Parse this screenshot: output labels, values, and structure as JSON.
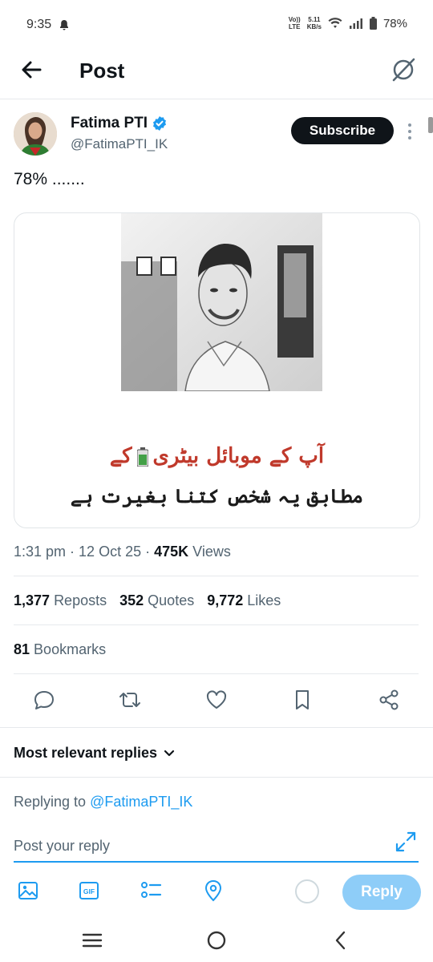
{
  "status_bar": {
    "time": "9:35",
    "volte": "Vo))\nLTE",
    "speed_value": "5.11",
    "speed_unit": "KB/s",
    "battery_text": "78%"
  },
  "header": {
    "title": "Post"
  },
  "author": {
    "name": "Fatima PTI",
    "handle": "@FatimaPTI_IK",
    "subscribe_label": "Subscribe"
  },
  "post": {
    "text": "78% .......",
    "image_caption_line1": "آپ کے موبائل بیٹری",
    "image_caption_line1_end": "کے",
    "image_caption_line2": "مطابق یہ شخص کتنا بغیرت ہے",
    "time": "1:31 pm",
    "date": "12 Oct 25",
    "views_count": "475K",
    "views_label": "Views"
  },
  "stats": {
    "reposts_count": "1,377",
    "reposts_label": "Reposts",
    "quotes_count": "352",
    "quotes_label": "Quotes",
    "likes_count": "9,772",
    "likes_label": "Likes",
    "bookmarks_count": "81",
    "bookmarks_label": "Bookmarks"
  },
  "replies": {
    "sort_label": "Most relevant replies",
    "replying_prefix": "Replying to",
    "replying_handle": "@FatimaPTI_IK",
    "input_placeholder": "Post your reply",
    "reply_button": "Reply"
  },
  "colors": {
    "accent": "#1d9bf0",
    "reply_button_disabled": "#8ecdf8",
    "text": "#0f1419",
    "secondary": "#536471"
  },
  "icons": [
    "arrow-left-icon",
    "grok-icon",
    "verified-icon",
    "more-icon",
    "comment-icon",
    "repost-icon",
    "heart-icon",
    "bookmark-icon",
    "share-icon",
    "chevron-down-icon",
    "expand-icon",
    "image-icon",
    "gif-icon",
    "poll-icon",
    "location-icon",
    "recent-apps-icon",
    "home-icon",
    "back-icon"
  ]
}
